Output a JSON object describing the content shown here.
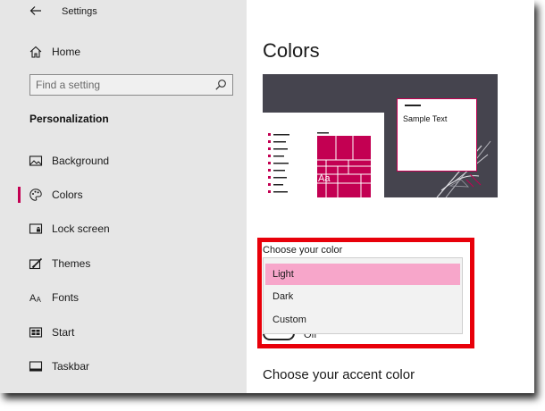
{
  "window": {
    "title": "Settings"
  },
  "sidebar": {
    "home_label": "Home",
    "search_placeholder": "Find a setting",
    "section_title": "Personalization",
    "items": [
      {
        "label": "Background",
        "icon": "image-icon",
        "selected": false
      },
      {
        "label": "Colors",
        "icon": "palette-icon",
        "selected": true
      },
      {
        "label": "Lock screen",
        "icon": "lock-screen-icon",
        "selected": false
      },
      {
        "label": "Themes",
        "icon": "brush-icon",
        "selected": false
      },
      {
        "label": "Fonts",
        "icon": "fonts-icon",
        "selected": false
      },
      {
        "label": "Start",
        "icon": "start-icon",
        "selected": false
      },
      {
        "label": "Taskbar",
        "icon": "taskbar-icon",
        "selected": false
      }
    ]
  },
  "main": {
    "title": "Colors",
    "preview": {
      "sample_text": "Sample Text",
      "tile_text": "Aa"
    },
    "choose_color": {
      "label": "Choose your color",
      "options": [
        "Light",
        "Dark",
        "Custom"
      ],
      "selected": "Light"
    },
    "toggle_state": "Off",
    "accent_heading": "Choose your accent color"
  },
  "colors": {
    "accent": "#c30052",
    "selected_option_bg": "#f7a6ca",
    "highlight_border": "#e8000a",
    "sidebar_bg": "#e6e6e6",
    "preview_bg": "#45444e"
  }
}
